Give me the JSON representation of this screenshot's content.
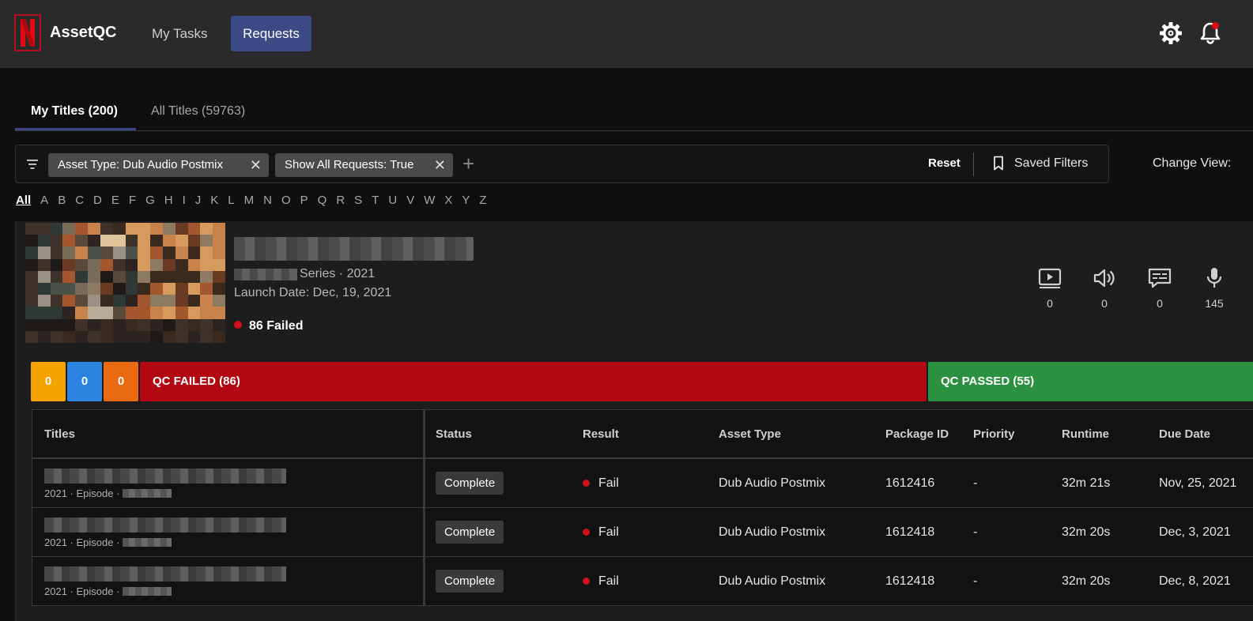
{
  "app": {
    "title": "AssetQC"
  },
  "nav": {
    "my_tasks": "My Tasks",
    "requests": "Requests"
  },
  "header_icons": [
    "gear-icon",
    "bell-icon"
  ],
  "notification_dot_color": "#e50914",
  "tabs": [
    {
      "label": "My Titles (200)",
      "active": true
    },
    {
      "label": "All Titles (59763)",
      "active": false
    }
  ],
  "filters": {
    "chips": [
      {
        "label": "Asset Type: Dub Audio Postmix"
      },
      {
        "label": "Show All Requests: True"
      }
    ],
    "reset_label": "Reset",
    "saved_label": "Saved Filters",
    "change_view_label": "Change View:"
  },
  "alphabet": [
    "All",
    "A",
    "B",
    "C",
    "D",
    "E",
    "F",
    "G",
    "H",
    "I",
    "J",
    "K",
    "L",
    "M",
    "N",
    "O",
    "P",
    "Q",
    "R",
    "S",
    "T",
    "U",
    "V",
    "W",
    "X",
    "Y",
    "Z"
  ],
  "title_card": {
    "meta": "Series · 2021",
    "launch": "Launch Date: Dec, 19, 2021",
    "failed": "86 Failed",
    "counts": [
      {
        "icon": "video-icon",
        "value": "0"
      },
      {
        "icon": "audio-icon",
        "value": "0"
      },
      {
        "icon": "subtitle-icon",
        "value": "0"
      },
      {
        "icon": "microphone-icon",
        "value": "145"
      }
    ]
  },
  "progress": {
    "yellow": "0",
    "blue": "0",
    "orange": "0",
    "failed": "QC FAILED (86)",
    "passed": "QC PASSED (55)"
  },
  "table": {
    "headers": {
      "titles": "Titles",
      "status": "Status",
      "result": "Result",
      "asset_type": "Asset Type",
      "package_id": "Package ID",
      "priority": "Priority",
      "runtime": "Runtime",
      "due_date": "Due Date"
    },
    "rows": [
      {
        "sub": "2021 · Episode ·",
        "status": "Complete",
        "result": "Fail",
        "asset_type": "Dub Audio Postmix",
        "package_id": "1612416",
        "priority": "-",
        "runtime": "32m 21s",
        "due_date": "Nov, 25, 2021"
      },
      {
        "sub": "2021 · Episode ·",
        "status": "Complete",
        "result": "Fail",
        "asset_type": "Dub Audio Postmix",
        "package_id": "1612418",
        "priority": "-",
        "runtime": "32m 20s",
        "due_date": "Dec, 3, 2021"
      },
      {
        "sub": "2021 · Episode ·",
        "status": "Complete",
        "result": "Fail",
        "asset_type": "Dub Audio Postmix",
        "package_id": "1612418",
        "priority": "-",
        "runtime": "32m 20s",
        "due_date": "Dec, 8, 2021"
      }
    ]
  }
}
